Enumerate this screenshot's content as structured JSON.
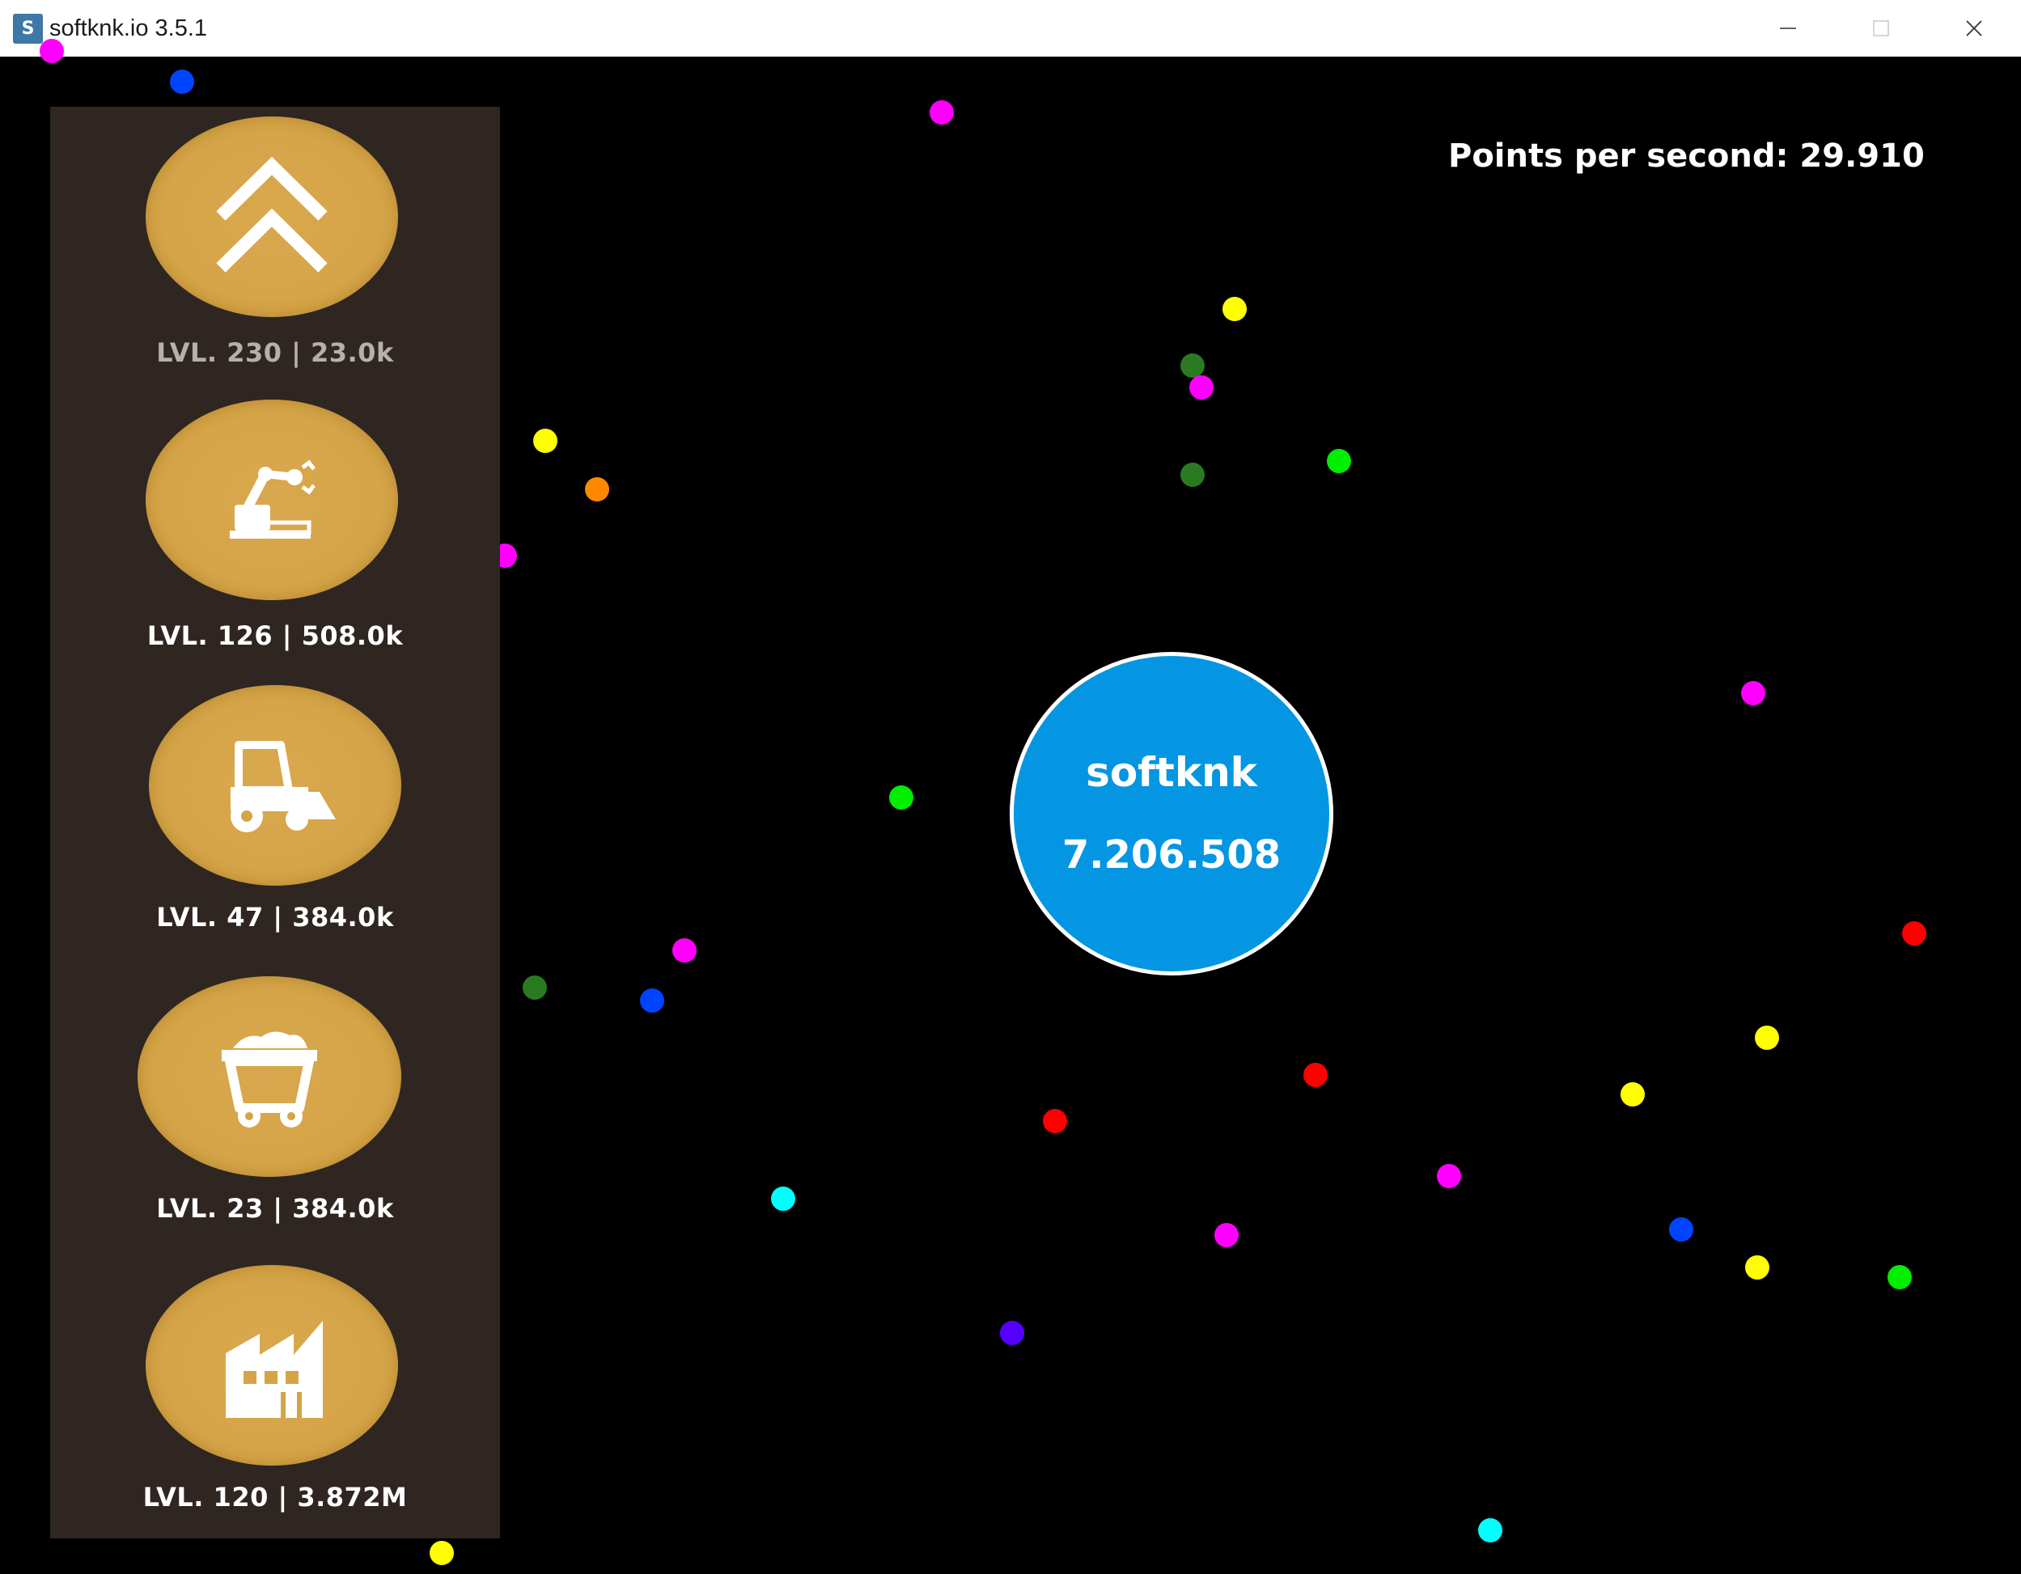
{
  "window": {
    "title": "softknk.io 3.5.1",
    "icon_letter": "S",
    "minimize_glyph": "—",
    "maximize_glyph": "☐",
    "close_glyph": "✕"
  },
  "hud": {
    "points_per_second": "Points per second: 29.910"
  },
  "player": {
    "name": "softknk",
    "score": "7.206.508",
    "color": "#0496e2"
  },
  "upgrades": [
    {
      "icon": "double-chevron-up-icon",
      "label": "LVL. 230  |  23.0k",
      "affordable": false
    },
    {
      "icon": "robot-arm-icon",
      "label": "LVL. 126  |  508.0k",
      "affordable": true
    },
    {
      "icon": "loader-vehicle-icon",
      "label": "LVL. 47  |  384.0k",
      "affordable": true
    },
    {
      "icon": "mine-cart-icon",
      "label": "LVL. 23  |  384.0k",
      "affordable": true
    },
    {
      "icon": "factory-icon",
      "label": "LVL. 120  |  3.872M",
      "affordable": true
    }
  ],
  "colors": {
    "background": "#000000",
    "sidebar": "#2f2622",
    "button_gold": "#d5a447",
    "dot_magenta": "#ff00ff",
    "dot_blue": "#0044ff",
    "dot_yellow": "#ffff00",
    "dot_green": "#00ee00",
    "dot_dark_green": "#2a7a22",
    "dot_orange": "#ff8800",
    "dot_red": "#ff0000",
    "dot_cyan": "#00ffff",
    "dot_purple": "#5500ff"
  }
}
